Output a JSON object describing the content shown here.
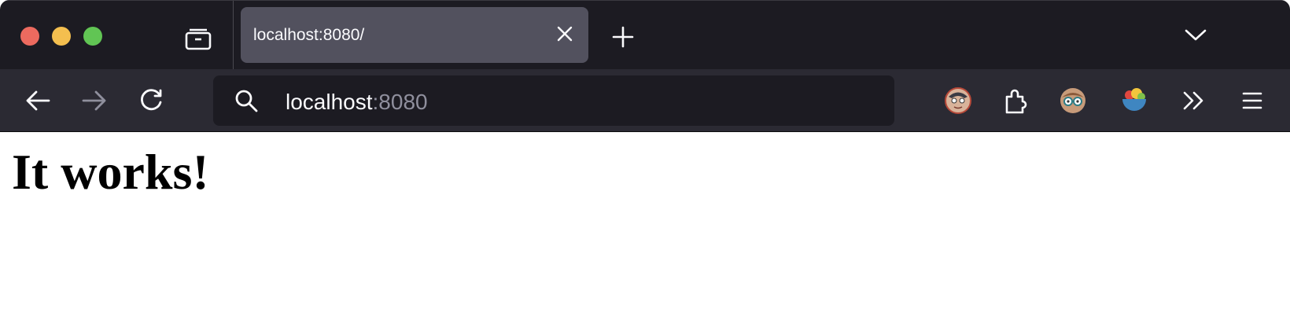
{
  "browser": {
    "tab": {
      "title": "localhost:8080/",
      "close_icon": "close-icon"
    },
    "tabstrip_icons": [
      "firefox-view-icon",
      "new-tab-icon",
      "list-all-tabs-icon"
    ],
    "address_bar": {
      "host": "localhost",
      "port": ":8080"
    },
    "toolbar_icons": [
      "back-arrow-icon",
      "forward-arrow-icon",
      "reload-icon",
      "search-icon",
      "extension-avatar-icon",
      "extensions-puzzle-icon",
      "extension-glasses-icon",
      "extension-bowl-icon",
      "overflow-chevrons-icon",
      "hamburger-menu-icon"
    ],
    "colors": {
      "tabstrip_bg": "#1c1b22",
      "selected_tab_bg": "#52515e",
      "navbar_bg": "#2b2a33",
      "urlbar_bg": "#1c1b22",
      "url_host": "#fbfbfe",
      "url_port": "#8f8f9d"
    }
  },
  "page": {
    "heading": "It works!"
  }
}
